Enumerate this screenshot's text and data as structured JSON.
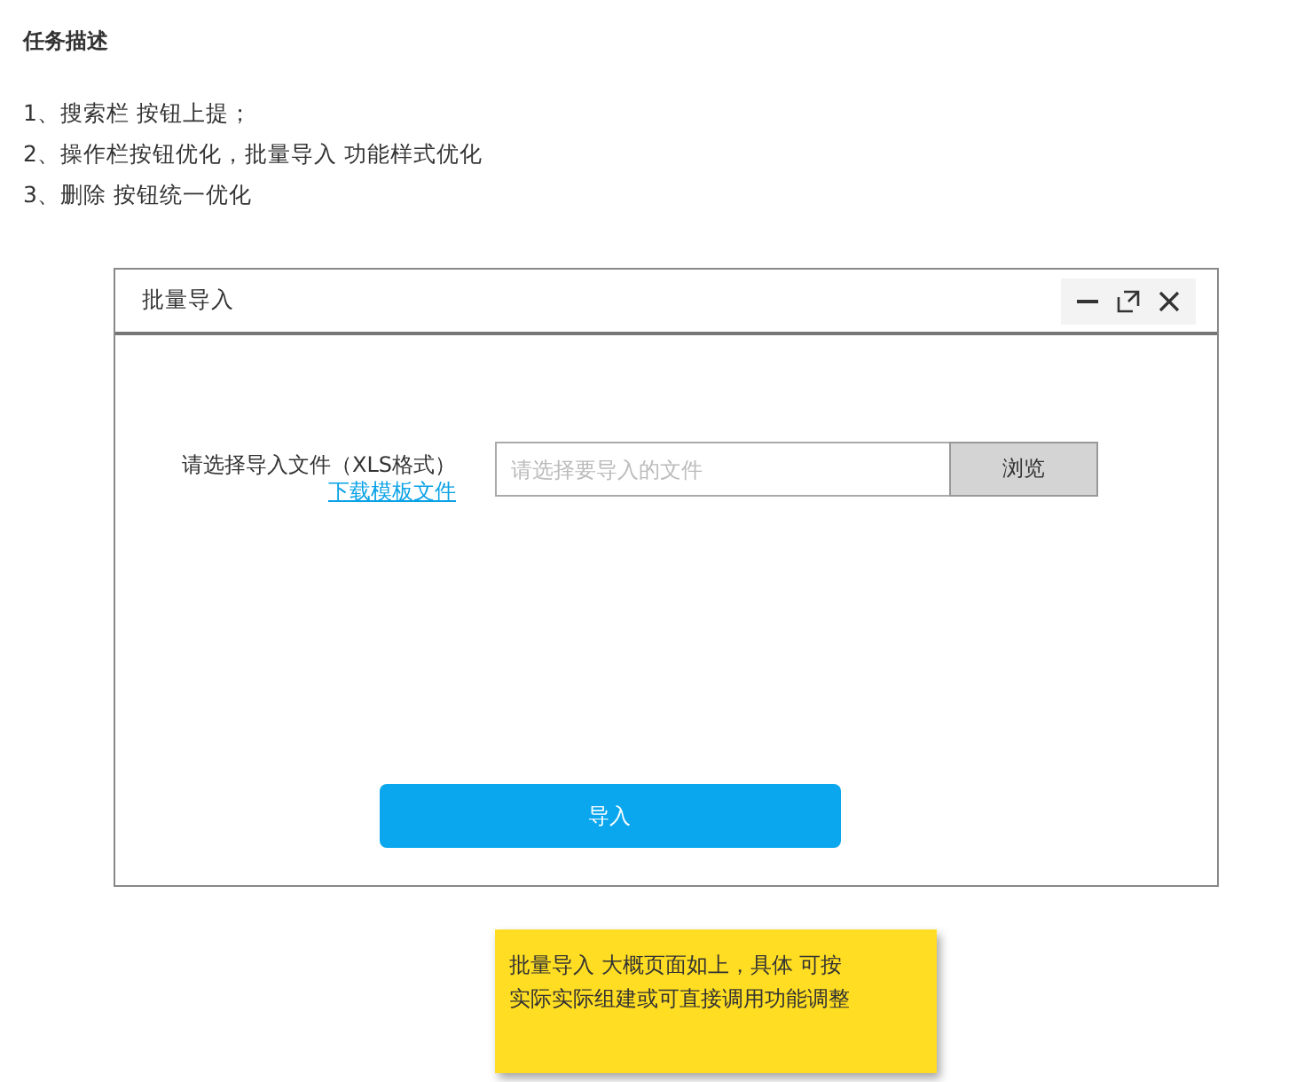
{
  "task": {
    "title": "任务描述",
    "items": [
      "1、搜索栏 按钮上提；",
      "2、操作栏按钮优化，批量导入 功能样式优化",
      "3、删除  按钮统一优化"
    ]
  },
  "dialog": {
    "title": "批量导入",
    "file_label": "请选择导入文件（XLS格式）",
    "template_link": "下载模板文件",
    "file_field": {
      "placeholder": "请选择要导入的文件"
    },
    "browse_button": "浏览",
    "import_button": "导入"
  },
  "note": {
    "text": "批量导入 大概页面如上，具体 可按实际实际组建或可直接调用功能调整"
  }
}
